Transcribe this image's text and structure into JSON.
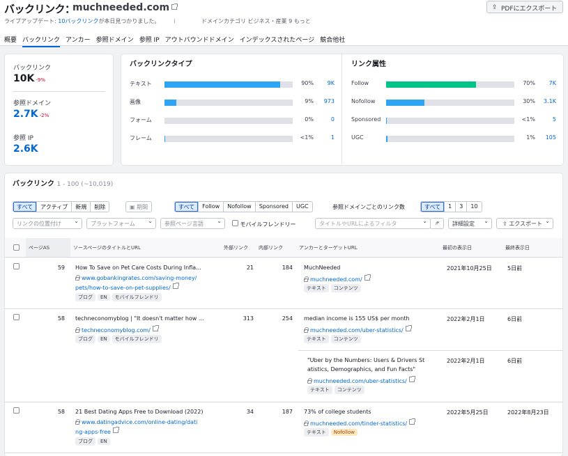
{
  "header": {
    "title": "バックリンク：",
    "domain": "muchneeded.com",
    "pdf_label": "PDFにエクスポート",
    "live_update_prefix": "ライブアップデート: ",
    "live_update_link": "10バックリンク",
    "live_update_suffix": "が本日見つかりました。",
    "info_mark": "i",
    "category": "ドメインカテゴリ ビジネス・産業 9 もっと"
  },
  "tabs": [
    "概要",
    "バックリンク",
    "アンカー",
    "参照ドメイン",
    "参照 IP",
    "アウトバウンドドメイン",
    "インデックスされたページ",
    "競合他社"
  ],
  "metrics": [
    {
      "label": "バックリンク",
      "value": "10K",
      "change": "-9%"
    },
    {
      "label": "参照ドメイン",
      "value": "2.7K",
      "change": "-2%"
    },
    {
      "label": "参照 IP",
      "value": "2.6K",
      "change": ""
    }
  ],
  "backlink_types": {
    "title": "バックリンクタイプ",
    "rows": [
      {
        "label": "テキスト",
        "fill": 0.9,
        "pct": "90%",
        "count": "9K"
      },
      {
        "label": "画像",
        "fill": 0.09,
        "pct": "9%",
        "count": "973"
      },
      {
        "label": "フォーム",
        "fill": 0.0,
        "pct": "0%",
        "count": "0"
      },
      {
        "label": "フレーム",
        "fill": 0.005,
        "pct": "<1%",
        "count": "1"
      }
    ]
  },
  "link_attributes": {
    "title": "リンク属性",
    "rows": [
      {
        "label": "Follow",
        "fill": 0.7,
        "pct": "70%",
        "count": "7K",
        "color": "#00c389"
      },
      {
        "label": "Nofollow",
        "fill": 0.3,
        "pct": "30%",
        "count": "3.1K",
        "color": "#2ea4f5"
      },
      {
        "label": "Sponsored",
        "fill": 0.005,
        "pct": "<1%",
        "count": "5",
        "color": "#2ea4f5"
      },
      {
        "label": "UGC",
        "fill": 0.01,
        "pct": "1%",
        "count": "105",
        "color": "#2ea4f5"
      }
    ]
  },
  "colors": {
    "bar_blue": "#2ea4f5",
    "bar_green": "#00c389",
    "accent": "#0068d1"
  },
  "list": {
    "title": "バックリンク",
    "range": "1 - 100 (~10,019)",
    "filter1": [
      "すべて",
      "アクティブ",
      "新規",
      "削除"
    ],
    "period": "期間",
    "filter2": [
      "すべて",
      "Follow",
      "Nofollow",
      "Sponsored",
      "UGC"
    ],
    "per_domain_label": "参照ドメインごとのリンク数",
    "filter3": [
      "すべて",
      "1",
      "3",
      "10"
    ],
    "dd_position": "リンクの位置付け",
    "dd_platform": "プラットフォーム",
    "dd_ref_page": "参照ページ言語",
    "mobile_label": "モバイルフレンドリー",
    "search_placeholder": "タイトルやURLによるフィルタ",
    "advanced": "詳細設定",
    "export": "エクスポート",
    "columns": [
      "ページAS",
      "ソースページのタイトルとURL",
      "外部リンク",
      "内部リンク",
      "アンカーとターゲットURL",
      "最初の表示日",
      "最終表示日"
    ]
  },
  "rows": [
    {
      "as": "59",
      "title": "How To Save on Pet Care Costs During Infla...",
      "url1": "www.gobankingrates.com/saving-money/",
      "url2": "pets/how-to-save-on-pet-supplies/",
      "tags": [
        "ブログ",
        "EN",
        "モバイルフレンドリ"
      ],
      "ext": "21",
      "int": "184",
      "anchors": [
        {
          "text": "MuchNeeded",
          "text2": "",
          "url": "muchneeded.com/",
          "tags": [
            "テキスト",
            "コンテンツ"
          ],
          "first": "2021年10月25日",
          "last": "5日前"
        }
      ]
    },
    {
      "as": "58",
      "title": "techneconomyblog | \"It doesn't matter how ...",
      "url1": "techneconomyblog.com/",
      "url2": "",
      "tags": [
        "ブログ",
        "EN",
        "モバイルフレンドリ"
      ],
      "ext": "313",
      "int": "254",
      "anchors": [
        {
          "text": "median income is 155 US$ per month",
          "text2": "",
          "url": "muchneeded.com/uber-statistics/",
          "tags": [
            "テキスト",
            "コンテンツ"
          ],
          "first": "2022年2月1日",
          "last": "6日前"
        },
        {
          "text": "\"Uber by the Numbers: Users & Drivers St",
          "text2": "atistics, Demographics, and Fun Facts\"",
          "url": "muchneeded.com/uber-statistics/",
          "tags": [
            "テキスト",
            "コンテンツ"
          ],
          "first": "2022年2月1日",
          "last": "6日前"
        }
      ]
    },
    {
      "as": "58",
      "title": "21 Best Dating Apps Free to Download (2022)",
      "url1": "www.datingadvice.com/online-dating/dati",
      "url2": "ng-apps-free",
      "tags": [
        "ブログ",
        "EN"
      ],
      "ext": "34",
      "int": "187",
      "anchors": [
        {
          "text": "73% of college students",
          "text2": "",
          "url": "muchneeded.com/tinder-statistics/",
          "tags": [
            "テキスト",
            "Nofollow"
          ],
          "first": "2022年5月25日",
          "last": "2022年8月23日"
        }
      ]
    }
  ]
}
